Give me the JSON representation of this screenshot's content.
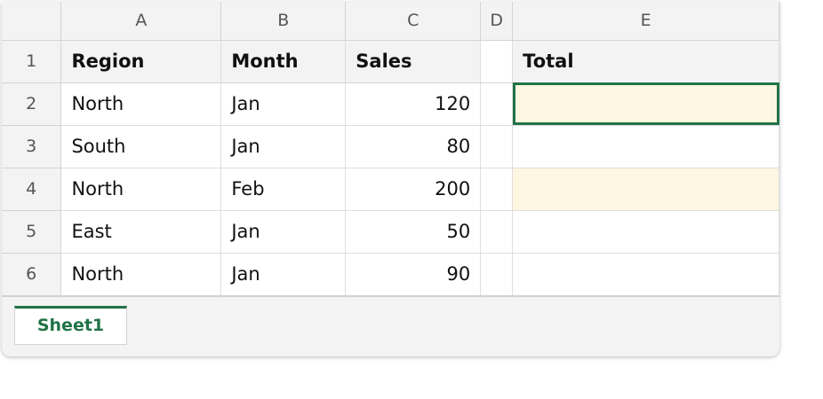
{
  "columns": [
    "A",
    "B",
    "C",
    "D",
    "E"
  ],
  "rows": [
    {
      "num": "1",
      "cells": [
        "Region",
        "Month",
        "Sales",
        "",
        "Total"
      ]
    },
    {
      "num": "2",
      "cells": [
        "North",
        "Jan",
        "120",
        "",
        ""
      ]
    },
    {
      "num": "3",
      "cells": [
        "South",
        "Jan",
        "80",
        "",
        ""
      ]
    },
    {
      "num": "4",
      "cells": [
        "North",
        "Feb",
        "200",
        "",
        ""
      ]
    },
    {
      "num": "5",
      "cells": [
        "East",
        "Jan",
        "50",
        "",
        ""
      ]
    },
    {
      "num": "6",
      "cells": [
        "North",
        "Jan",
        "90",
        "",
        ""
      ]
    }
  ],
  "selected_cell": "E2",
  "sheet_tabs": [
    {
      "label": "Sheet1",
      "active": true
    }
  ],
  "colors": {
    "accent": "#217346",
    "highlight_fill": "#fdf6e1",
    "header_bg": "#f3f3f3"
  }
}
